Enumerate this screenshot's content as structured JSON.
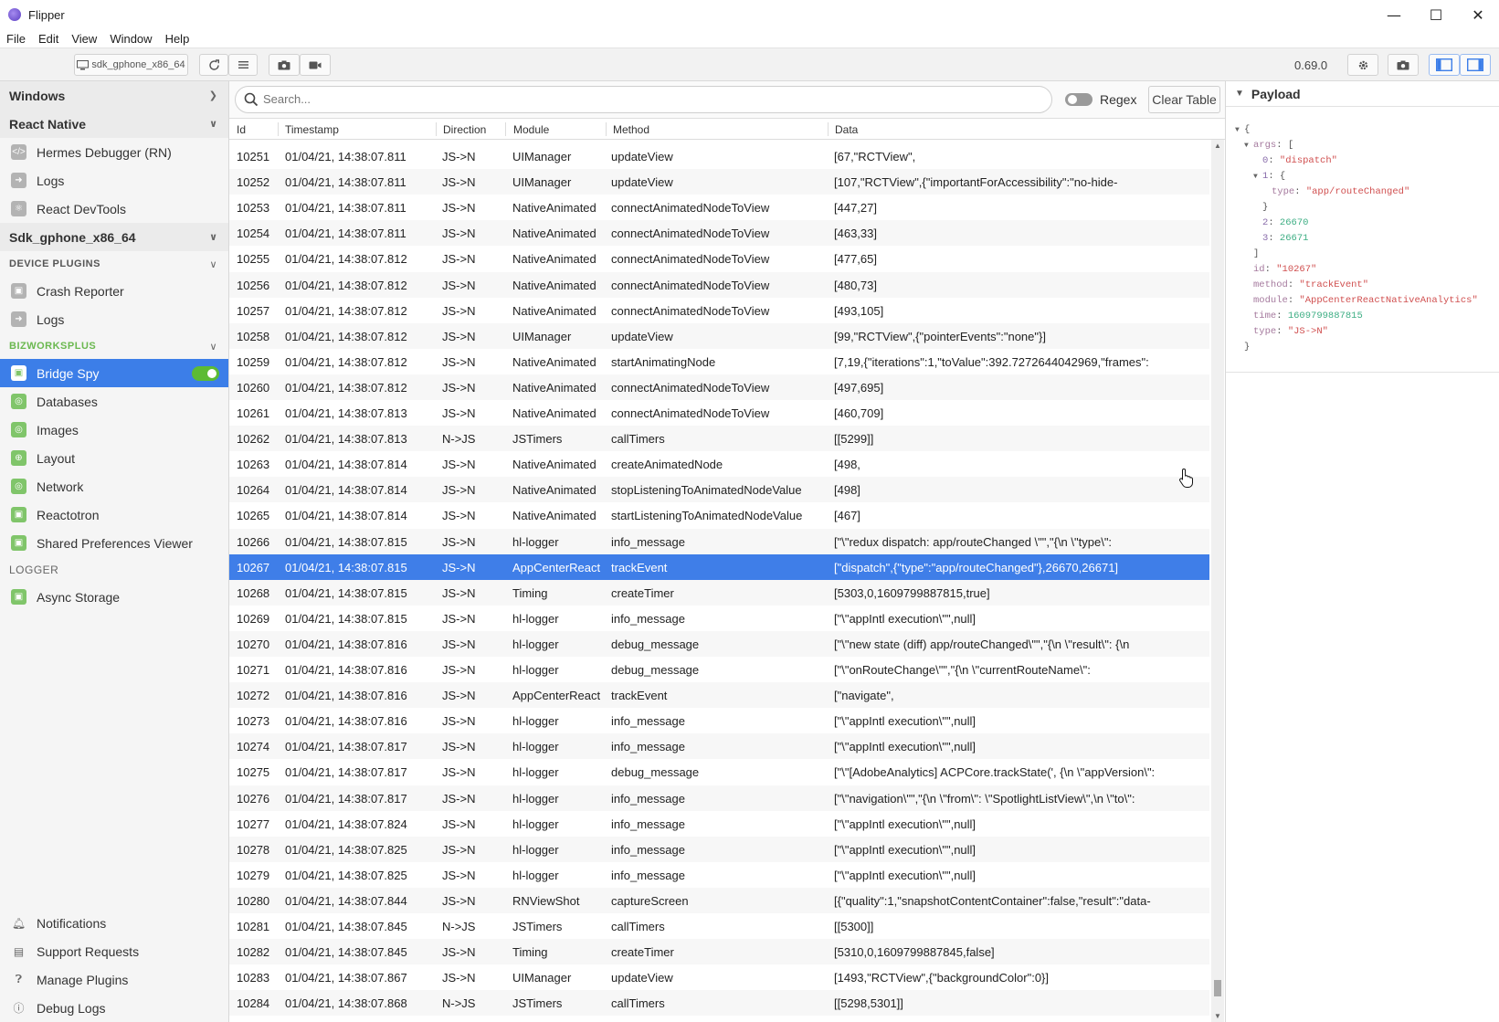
{
  "window": {
    "title": "Flipper",
    "minimize": "—",
    "maximize": "☐",
    "close": "✕"
  },
  "menu": [
    "File",
    "Edit",
    "View",
    "Window",
    "Help"
  ],
  "toolbar": {
    "device": "sdk_gphone_x86_64",
    "version": "0.69.0"
  },
  "sidebar": {
    "windows": "Windows",
    "react_native": "React Native",
    "rn_items": [
      "Hermes Debugger (RN)",
      "Logs",
      "React DevTools"
    ],
    "device": "Sdk_gphone_x86_64",
    "device_plugins": "DEVICE PLUGINS",
    "device_items": [
      "Crash Reporter",
      "Logs"
    ],
    "bizworks": "BIZWORKSPLUS",
    "biz_items": [
      "Bridge Spy",
      "Databases",
      "Images",
      "Layout",
      "Network",
      "Reactotron",
      "Shared Preferences Viewer"
    ],
    "logger": "LOGGER",
    "logger_items": [
      "Async Storage"
    ],
    "bottom": [
      "Notifications",
      "Support Requests",
      "Manage Plugins",
      "Debug Logs"
    ]
  },
  "search": {
    "placeholder": "Search...",
    "regex": "Regex",
    "clear": "Clear Table"
  },
  "columns": [
    "Id",
    "Timestamp",
    "Direction",
    "Module",
    "Method",
    "Data"
  ],
  "rows": [
    [
      "10251",
      "01/04/21, 14:38:07.811",
      "JS->N",
      "UIManager",
      "updateView",
      "[67,\"RCTView\","
    ],
    [
      "10252",
      "01/04/21, 14:38:07.811",
      "JS->N",
      "UIManager",
      "updateView",
      "[107,\"RCTView\",{\"importantForAccessibility\":\"no-hide-"
    ],
    [
      "10253",
      "01/04/21, 14:38:07.811",
      "JS->N",
      "NativeAnimated",
      "connectAnimatedNodeToView",
      "[447,27]"
    ],
    [
      "10254",
      "01/04/21, 14:38:07.811",
      "JS->N",
      "NativeAnimated",
      "connectAnimatedNodeToView",
      "[463,33]"
    ],
    [
      "10255",
      "01/04/21, 14:38:07.812",
      "JS->N",
      "NativeAnimated",
      "connectAnimatedNodeToView",
      "[477,65]"
    ],
    [
      "10256",
      "01/04/21, 14:38:07.812",
      "JS->N",
      "NativeAnimated",
      "connectAnimatedNodeToView",
      "[480,73]"
    ],
    [
      "10257",
      "01/04/21, 14:38:07.812",
      "JS->N",
      "NativeAnimated",
      "connectAnimatedNodeToView",
      "[493,105]"
    ],
    [
      "10258",
      "01/04/21, 14:38:07.812",
      "JS->N",
      "UIManager",
      "updateView",
      "[99,\"RCTView\",{\"pointerEvents\":\"none\"}]"
    ],
    [
      "10259",
      "01/04/21, 14:38:07.812",
      "JS->N",
      "NativeAnimated",
      "startAnimatingNode",
      "[7,19,{\"iterations\":1,\"toValue\":392.7272644042969,\"frames\":"
    ],
    [
      "10260",
      "01/04/21, 14:38:07.812",
      "JS->N",
      "NativeAnimated",
      "connectAnimatedNodeToView",
      "[497,695]"
    ],
    [
      "10261",
      "01/04/21, 14:38:07.813",
      "JS->N",
      "NativeAnimated",
      "connectAnimatedNodeToView",
      "[460,709]"
    ],
    [
      "10262",
      "01/04/21, 14:38:07.813",
      "N->JS",
      "JSTimers",
      "callTimers",
      "[[5299]]"
    ],
    [
      "10263",
      "01/04/21, 14:38:07.814",
      "JS->N",
      "NativeAnimated",
      "createAnimatedNode",
      "[498,"
    ],
    [
      "10264",
      "01/04/21, 14:38:07.814",
      "JS->N",
      "NativeAnimated",
      "stopListeningToAnimatedNodeValue",
      "[498]"
    ],
    [
      "10265",
      "01/04/21, 14:38:07.814",
      "JS->N",
      "NativeAnimated",
      "startListeningToAnimatedNodeValue",
      "[467]"
    ],
    [
      "10266",
      "01/04/21, 14:38:07.815",
      "JS->N",
      "hl-logger",
      "info_message",
      "[\"\\\"redux dispatch: app/routeChanged \\\"\",\"{\\n \\\"type\\\":"
    ],
    [
      "10267",
      "01/04/21, 14:38:07.815",
      "JS->N",
      "AppCenterReact",
      "trackEvent",
      "[\"dispatch\",{\"type\":\"app/routeChanged\"},26670,26671]"
    ],
    [
      "10268",
      "01/04/21, 14:38:07.815",
      "JS->N",
      "Timing",
      "createTimer",
      "[5303,0,1609799887815,true]"
    ],
    [
      "10269",
      "01/04/21, 14:38:07.815",
      "JS->N",
      "hl-logger",
      "info_message",
      "[\"\\\"appIntl execution\\\"\",null]"
    ],
    [
      "10270",
      "01/04/21, 14:38:07.816",
      "JS->N",
      "hl-logger",
      "debug_message",
      "[\"\\\"new state (diff) app/routeChanged\\\"\",\"{\\n \\\"result\\\": {\\n"
    ],
    [
      "10271",
      "01/04/21, 14:38:07.816",
      "JS->N",
      "hl-logger",
      "debug_message",
      "[\"\\\"onRouteChange\\\"\",\"{\\n \\\"currentRouteName\\\":"
    ],
    [
      "10272",
      "01/04/21, 14:38:07.816",
      "JS->N",
      "AppCenterReact",
      "trackEvent",
      "[\"navigate\","
    ],
    [
      "10273",
      "01/04/21, 14:38:07.816",
      "JS->N",
      "hl-logger",
      "info_message",
      "[\"\\\"appIntl execution\\\"\",null]"
    ],
    [
      "10274",
      "01/04/21, 14:38:07.817",
      "JS->N",
      "hl-logger",
      "info_message",
      "[\"\\\"appIntl execution\\\"\",null]"
    ],
    [
      "10275",
      "01/04/21, 14:38:07.817",
      "JS->N",
      "hl-logger",
      "debug_message",
      "[\"\\\"[AdobeAnalytics] ACPCore.trackState(', {\\n \\\"appVersion\\\":"
    ],
    [
      "10276",
      "01/04/21, 14:38:07.817",
      "JS->N",
      "hl-logger",
      "info_message",
      "[\"\\\"navigation\\\"\",\"{\\n \\\"from\\\": \\\"SpotlightListView\\\",\\n \\\"to\\\":"
    ],
    [
      "10277",
      "01/04/21, 14:38:07.824",
      "JS->N",
      "hl-logger",
      "info_message",
      "[\"\\\"appIntl execution\\\"\",null]"
    ],
    [
      "10278",
      "01/04/21, 14:38:07.825",
      "JS->N",
      "hl-logger",
      "info_message",
      "[\"\\\"appIntl execution\\\"\",null]"
    ],
    [
      "10279",
      "01/04/21, 14:38:07.825",
      "JS->N",
      "hl-logger",
      "info_message",
      "[\"\\\"appIntl execution\\\"\",null]"
    ],
    [
      "10280",
      "01/04/21, 14:38:07.844",
      "JS->N",
      "RNViewShot",
      "captureScreen",
      "[{\"quality\":1,\"snapshotContentContainer\":false,\"result\":\"data-"
    ],
    [
      "10281",
      "01/04/21, 14:38:07.845",
      "N->JS",
      "JSTimers",
      "callTimers",
      "[[5300]]"
    ],
    [
      "10282",
      "01/04/21, 14:38:07.845",
      "JS->N",
      "Timing",
      "createTimer",
      "[5310,0,1609799887845,false]"
    ],
    [
      "10283",
      "01/04/21, 14:38:07.867",
      "JS->N",
      "UIManager",
      "updateView",
      "[1493,\"RCTView\",{\"backgroundColor\":0}]"
    ],
    [
      "10284",
      "01/04/21, 14:38:07.868",
      "N->JS",
      "JSTimers",
      "callTimers",
      "[[5298,5301]]"
    ]
  ],
  "selected_id": "10267",
  "payload": {
    "title": "Payload",
    "lines": [
      {
        "indent": 0,
        "tri": true,
        "parts": [
          [
            "p",
            "{"
          ]
        ]
      },
      {
        "indent": 1,
        "tri": true,
        "parts": [
          [
            "k",
            "args"
          ],
          [
            "p",
            ": ["
          ]
        ]
      },
      {
        "indent": 2,
        "tri": false,
        "parts": [
          [
            "k2",
            "0"
          ],
          [
            "p",
            ": "
          ],
          [
            "s",
            "\"dispatch\""
          ]
        ]
      },
      {
        "indent": 2,
        "tri": true,
        "parts": [
          [
            "k2",
            "1"
          ],
          [
            "p",
            ": {"
          ]
        ]
      },
      {
        "indent": 3,
        "tri": false,
        "parts": [
          [
            "k",
            "type"
          ],
          [
            "p",
            ": "
          ],
          [
            "s",
            "\"app/routeChanged\""
          ]
        ]
      },
      {
        "indent": 2,
        "tri": false,
        "parts": [
          [
            "p",
            "}"
          ]
        ]
      },
      {
        "indent": 2,
        "tri": false,
        "parts": [
          [
            "k2",
            "2"
          ],
          [
            "p",
            ": "
          ],
          [
            "n",
            "26670"
          ]
        ]
      },
      {
        "indent": 2,
        "tri": false,
        "parts": [
          [
            "k2",
            "3"
          ],
          [
            "p",
            ": "
          ],
          [
            "n",
            "26671"
          ]
        ]
      },
      {
        "indent": 1,
        "tri": false,
        "parts": [
          [
            "p",
            "]"
          ]
        ]
      },
      {
        "indent": 1,
        "tri": false,
        "parts": [
          [
            "k",
            "id"
          ],
          [
            "p",
            ": "
          ],
          [
            "s",
            "\"10267\""
          ]
        ]
      },
      {
        "indent": 1,
        "tri": false,
        "parts": [
          [
            "k",
            "method"
          ],
          [
            "p",
            ": "
          ],
          [
            "s",
            "\"trackEvent\""
          ]
        ]
      },
      {
        "indent": 1,
        "tri": false,
        "parts": [
          [
            "k",
            "module"
          ],
          [
            "p",
            ": "
          ],
          [
            "s",
            "\"AppCenterReactNativeAnalytics\""
          ]
        ]
      },
      {
        "indent": 1,
        "tri": false,
        "parts": [
          [
            "k",
            "time"
          ],
          [
            "p",
            ": "
          ],
          [
            "n",
            "1609799887815"
          ]
        ]
      },
      {
        "indent": 1,
        "tri": false,
        "parts": [
          [
            "k",
            "type"
          ],
          [
            "p",
            ": "
          ],
          [
            "s",
            "\"JS->N\""
          ]
        ]
      },
      {
        "indent": 0,
        "tri": false,
        "parts": [
          [
            "p",
            "}"
          ]
        ]
      }
    ]
  },
  "colors": {
    "selection": "#3f7ee8",
    "accent_green": "#80c56a",
    "toggle_on": "#5cbb34"
  }
}
